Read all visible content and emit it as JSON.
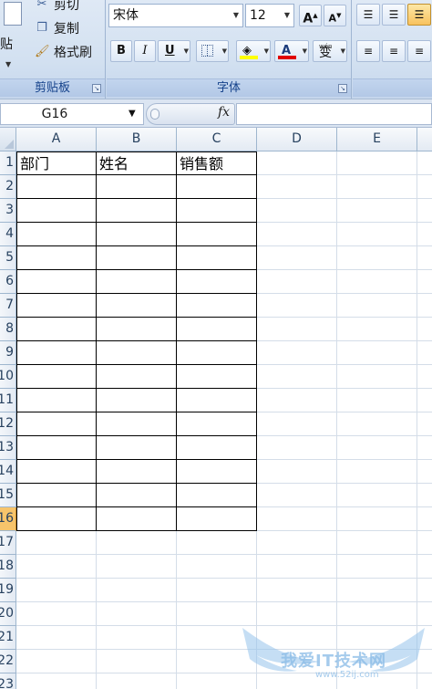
{
  "ribbon": {
    "clipboard": {
      "paste_label": "粘贴",
      "cut_label": "剪切",
      "copy_label": "复制",
      "format_painter_label": "格式刷",
      "group_label": "剪贴板"
    },
    "font": {
      "font_name": "宋体",
      "font_size": "12",
      "grow_label": "A",
      "shrink_label": "A",
      "bold_label": "B",
      "italic_label": "I",
      "underline_label": "U",
      "font_color_label": "A",
      "phonetic_label": "变",
      "phonetic_top": "wén",
      "group_label": "字体",
      "fill_color": "#ffff00",
      "font_color": "#e00000"
    }
  },
  "formula_bar": {
    "name_box": "G16",
    "fx_label": "fx",
    "formula": ""
  },
  "grid": {
    "columns": [
      "A",
      "B",
      "C",
      "D",
      "E"
    ],
    "rows": [
      "1",
      "2",
      "3",
      "4",
      "5",
      "6",
      "7",
      "8",
      "9",
      "10",
      "11",
      "12",
      "13",
      "14",
      "15",
      "16",
      "17",
      "18",
      "19",
      "20",
      "21",
      "22",
      "23"
    ],
    "selected_row": "16",
    "headers": [
      "部门",
      "姓名",
      "销售额"
    ]
  },
  "watermark": {
    "text": "我爱IT技术网",
    "url": "www.52ij.com"
  }
}
